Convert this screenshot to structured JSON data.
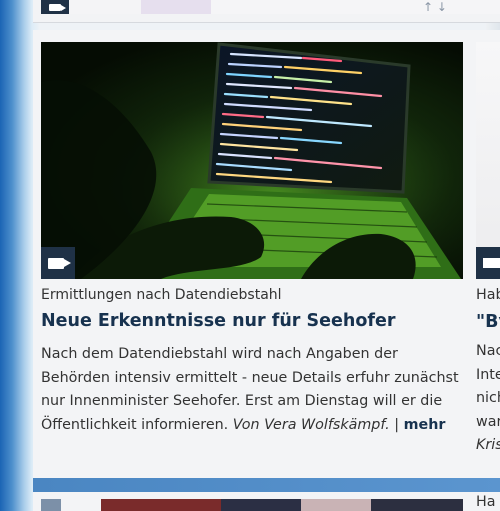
{
  "article": {
    "topline": "Ermittlungen nach Datendiebstahl",
    "headline": "Neue Erkenntnisse nur für Seehofer",
    "text": "Nach dem Datendiebstahl wird nach Angaben der Behörden intensiv ermittelt - neue Details erfuhr zunächst nur Innenminister Seehofer. Erst am Dienstag will er die Öffentlichkeit informieren.",
    "author": "Von Vera Wolfskämpf.",
    "separator": "|",
    "more": "mehr"
  },
  "right_card": {
    "topline_partial": "Hab",
    "headline_partial": "\"By",
    "text_lines": [
      "Nac",
      "Inte",
      "nich",
      "war",
      "Kris"
    ]
  },
  "bottom_card": {
    "topline_partial": "Ha"
  },
  "icons": {
    "video": "video-camera-icon"
  },
  "colors": {
    "headline": "#17324f",
    "badge": "#1f3146",
    "page_blue": "#1b64b4"
  }
}
